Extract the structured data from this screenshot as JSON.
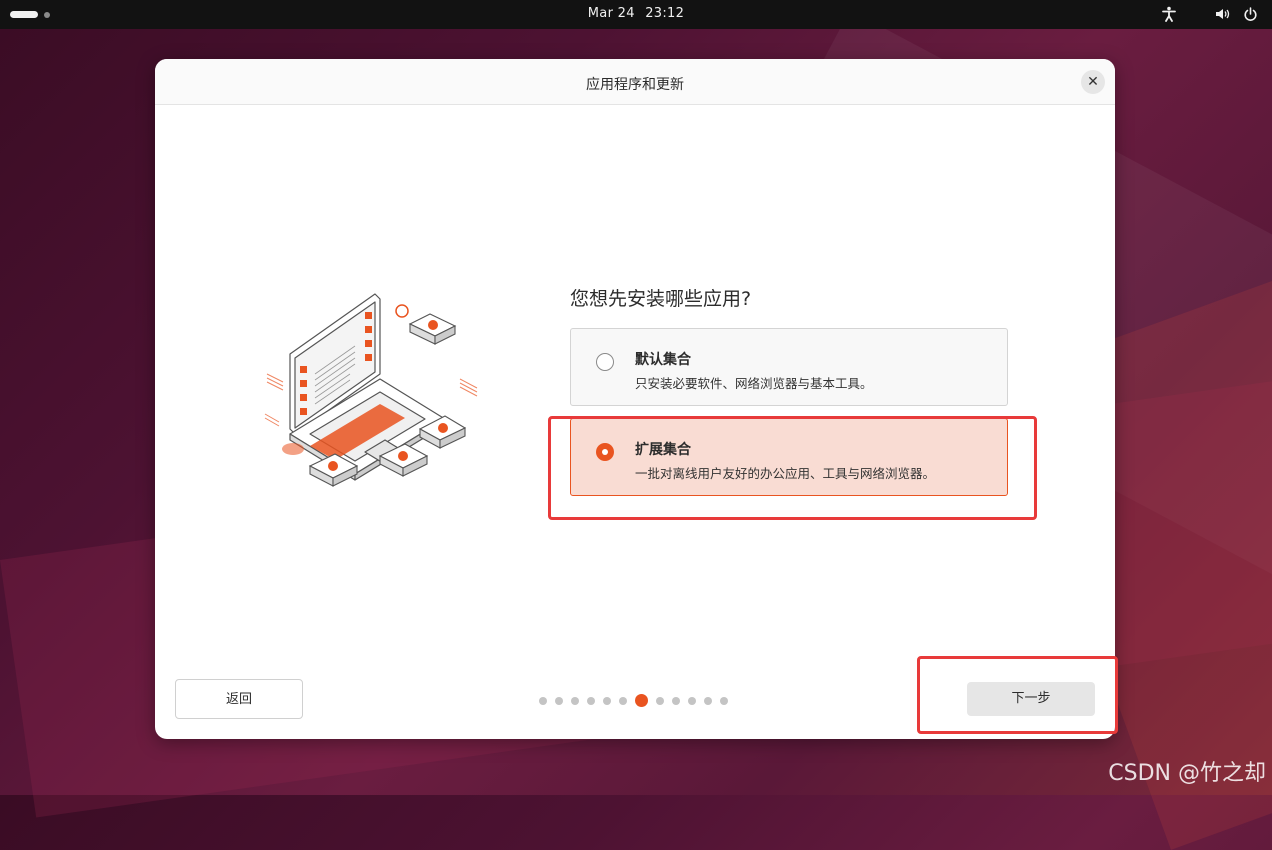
{
  "topbar": {
    "date": "Mar 24",
    "time": "23:12",
    "icons": [
      "accessibility-icon",
      "volume-icon",
      "power-icon"
    ]
  },
  "dialog": {
    "title": "应用程序和更新",
    "question": "您想先安装哪些应用?",
    "options": [
      {
        "title": "默认集合",
        "description": "只安装必要软件、网络浏览器与基本工具。",
        "selected": false
      },
      {
        "title": "扩展集合",
        "description": "一批对离线用户友好的办公应用、工具与网络浏览器。",
        "selected": true
      }
    ],
    "back_label": "返回",
    "next_label": "下一步",
    "progress": {
      "total_steps": 12,
      "current_step": 7
    }
  },
  "colors": {
    "accent": "#e95420",
    "highlight": "#e83a3a"
  },
  "watermark": "CSDN @竹之却"
}
